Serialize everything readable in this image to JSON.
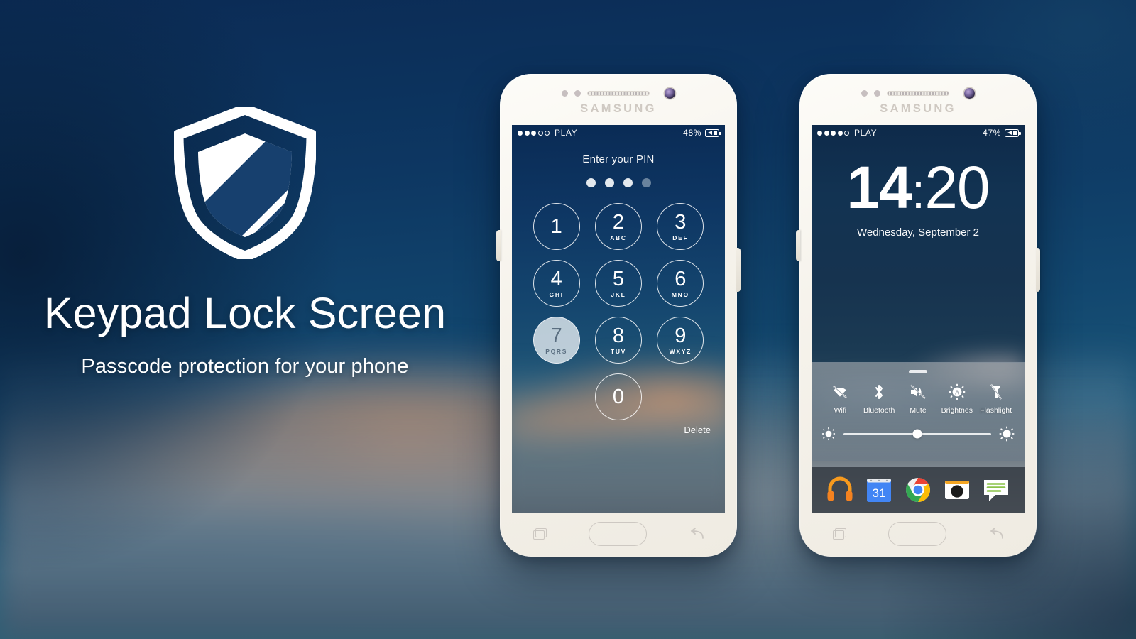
{
  "page": {
    "background_color": "#0d2f5c",
    "accent_color": "#ffffff"
  },
  "hero": {
    "logo_icon": "shield-icon",
    "title": "Keypad Lock Screen",
    "subtitle": "Passcode protection for your phone"
  },
  "phone_one": {
    "brand": "SAMSUNG",
    "status_bar": {
      "signal_dots_total": 5,
      "signal_dots_filled": 3,
      "carrier": "PLAY",
      "battery_percent": "48%",
      "battery_icon": "battery-charging-icon"
    },
    "pin_screen": {
      "prompt": "Enter your PIN",
      "pin_dots_total": 4,
      "pin_dots_filled": 3,
      "keys": [
        {
          "digit": "1",
          "letters": ""
        },
        {
          "digit": "2",
          "letters": "ABC"
        },
        {
          "digit": "3",
          "letters": "DEF"
        },
        {
          "digit": "4",
          "letters": "GHI"
        },
        {
          "digit": "5",
          "letters": "JKL"
        },
        {
          "digit": "6",
          "letters": "MNO"
        },
        {
          "digit": "7",
          "letters": "PQRS"
        },
        {
          "digit": "8",
          "letters": "TUV"
        },
        {
          "digit": "9",
          "letters": "WXYZ"
        },
        {
          "digit": "0",
          "letters": ""
        }
      ],
      "pressed_key": "7",
      "delete_label": "Delete"
    },
    "nav_bar": {
      "recents_icon": "recents-icon",
      "home_icon": "home-button-icon",
      "back_icon": "back-icon"
    }
  },
  "phone_two": {
    "brand": "SAMSUNG",
    "status_bar": {
      "signal_dots_total": 5,
      "signal_dots_filled": 4,
      "carrier": "PLAY",
      "battery_percent": "47%",
      "battery_icon": "battery-charging-icon"
    },
    "lock_screen": {
      "clock_hours": "14",
      "clock_separator": ":",
      "clock_minutes": "20",
      "date": "Wednesday, September 2"
    },
    "quick_settings": {
      "handle_icon": "drag-handle-icon",
      "toggles": [
        {
          "label": "Wifi",
          "icon": "wifi-off-icon",
          "state": "off"
        },
        {
          "label": "Bluetooth",
          "icon": "bluetooth-icon",
          "state": "on"
        },
        {
          "label": "Mute",
          "icon": "volume-mute-icon",
          "state": "on"
        },
        {
          "label": "Brightnes",
          "icon": "auto-brightness-icon",
          "state": "on"
        },
        {
          "label": "Flashlight",
          "icon": "flashlight-off-icon",
          "state": "off"
        }
      ],
      "brightness_slider": {
        "low_icon": "brightness-low-icon",
        "high_icon": "brightness-high-icon",
        "value_percent": 50
      }
    },
    "dock": {
      "apps": [
        {
          "name": "play-music-app-icon",
          "label": "Play Music"
        },
        {
          "name": "calendar-app-icon",
          "label": "Calendar",
          "date_number": "31"
        },
        {
          "name": "chrome-app-icon",
          "label": "Chrome"
        },
        {
          "name": "camera-app-icon",
          "label": "Camera"
        },
        {
          "name": "messages-app-icon",
          "label": "Messages"
        }
      ]
    },
    "nav_bar": {
      "recents_icon": "recents-icon",
      "home_icon": "home-button-icon",
      "back_icon": "back-icon"
    }
  }
}
